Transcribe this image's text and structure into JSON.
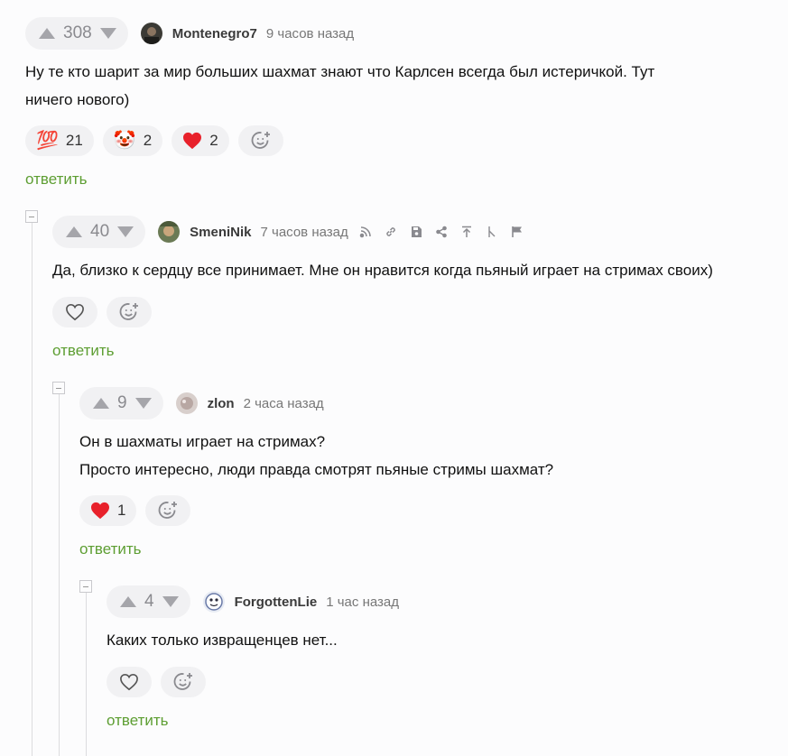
{
  "colors": {
    "accent_green": "#5d9e32",
    "heart_red": "#e8212b",
    "muted": "#8a8a8f"
  },
  "comments": [
    {
      "rating": "308",
      "author": "Montenegro7",
      "time": "9 часов назад",
      "text_lines": [
        "Ну те кто шарит за мир больших шахмат знают что Карлсен всегда был истеричкой. Тут",
        "ничего нового)"
      ],
      "reactions": [
        {
          "icon": "hundred-points-emoji",
          "emoji": "💯",
          "count": "21"
        },
        {
          "icon": "clown-face-emoji",
          "emoji": "🤡",
          "count": "2"
        },
        {
          "icon": "red-heart-icon",
          "count": "2"
        }
      ],
      "reply": "ответить"
    },
    {
      "rating": "40",
      "author": "SmeniNik",
      "time": "7 часов назад",
      "tools": [
        "thread-icon",
        "link-icon",
        "save-icon",
        "share-icon",
        "go-to-parent-icon",
        "tree-icon",
        "report-flag-icon"
      ],
      "text_lines": [
        "Да, близко к сердцу все принимает. Мне он нравится когда пьяный играет на стримах своих)"
      ],
      "reply": "ответить"
    },
    {
      "rating": "9",
      "author": "zlon",
      "time": "2 часа назад",
      "text_lines": [
        "Он в шахматы играет на стримах?",
        "Просто интересно, люди правда смотрят пьяные стримы шахмат?"
      ],
      "reactions": [
        {
          "icon": "red-heart-icon",
          "count": "1"
        }
      ],
      "reply": "ответить"
    },
    {
      "rating": "4",
      "author": "ForgottenLie",
      "time": "1 час назад",
      "text_lines": [
        "Каких только извращенцев нет..."
      ],
      "reply": "ответить"
    }
  ]
}
